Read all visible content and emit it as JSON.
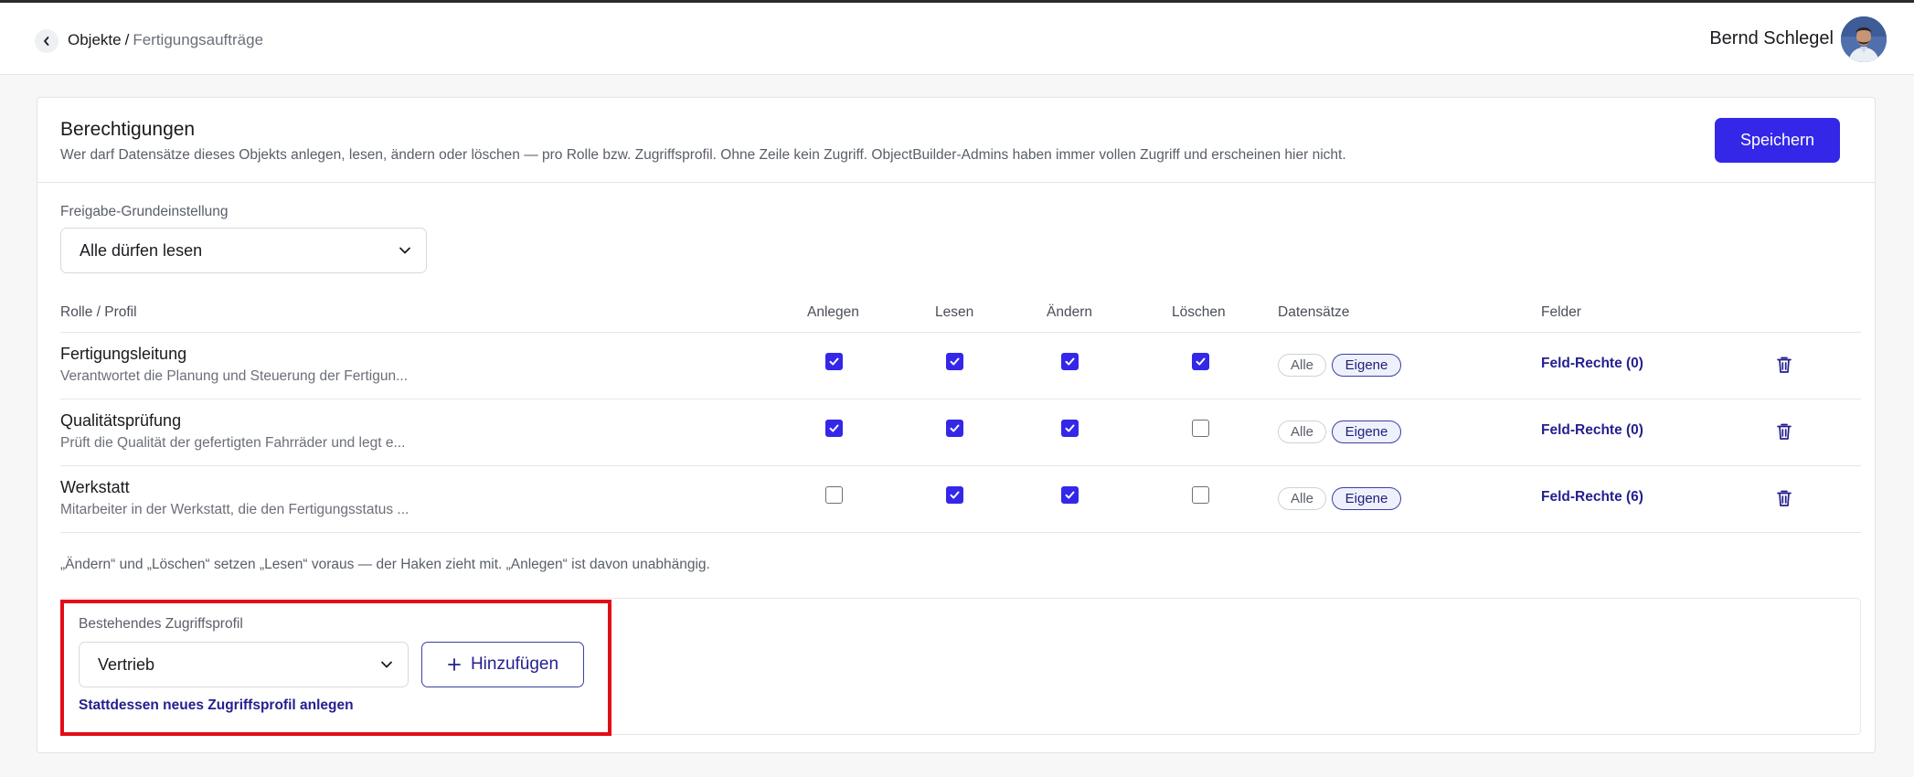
{
  "header": {
    "breadcrumb_root": "Objekte",
    "breadcrumb_separator": "/",
    "breadcrumb_current": "Fertigungsaufträge",
    "user_name": "Bernd Schlegel"
  },
  "permissions": {
    "title": "Berechtigungen",
    "description": "Wer darf Datensätze dieses Objekts anlegen, lesen, ändern oder löschen — pro Rolle bzw. Zugriffsprofil. Ohne Zeile kein Zugriff. ObjectBuilder-Admins haben immer vollen Zugriff und erscheinen hier nicht.",
    "save_label": "Speichern",
    "default_share_label": "Freigabe-Grundeinstellung",
    "default_share_value": "Alle dürfen lesen",
    "columns": {
      "role": "Rolle / Profil",
      "create": "Anlegen",
      "read": "Lesen",
      "update": "Ändern",
      "delete": "Löschen",
      "records": "Datensätze",
      "fields": "Felder"
    },
    "rows": [
      {
        "name": "Fertigungsleitung",
        "description": "Verantwortet die Planung und Steuerung der Fertigun...",
        "create": true,
        "read": true,
        "update": true,
        "delete": true,
        "records_options": [
          "Alle",
          "Eigene"
        ],
        "records_selected": "Eigene",
        "fields_link": "Feld-Rechte (0)"
      },
      {
        "name": "Qualitätsprüfung",
        "description": "Prüft die Qualität der gefertigten Fahrräder und legt e...",
        "create": true,
        "read": true,
        "update": true,
        "delete": false,
        "records_options": [
          "Alle",
          "Eigene"
        ],
        "records_selected": "Eigene",
        "fields_link": "Feld-Rechte (0)"
      },
      {
        "name": "Werkstatt",
        "description": "Mitarbeiter in der Werkstatt, die den Fertigungsstatus ...",
        "create": false,
        "read": true,
        "update": true,
        "delete": false,
        "records_options": [
          "Alle",
          "Eigene"
        ],
        "records_selected": "Eigene",
        "fields_link": "Feld-Rechte (6)"
      }
    ],
    "note": "„Ändern“ und „Löschen“ setzen „Lesen“ voraus — der Haken zieht mit. „Anlegen“ ist davon unabhängig.",
    "add_profile": {
      "label": "Bestehendes Zugriffsprofil",
      "selected": "Vertrieb",
      "add_label": "Hinzufügen",
      "new_profile_link": "Stattdessen neues Zugriffsprofil anlegen"
    }
  },
  "colors": {
    "accent": "#3427e8",
    "link": "#241f8e",
    "highlight": "#e20d16"
  },
  "icons": {
    "back": "chevron-left-icon",
    "select": "chevron-down-icon",
    "delete": "trash-icon",
    "add": "plus-icon",
    "check": "check-icon"
  }
}
